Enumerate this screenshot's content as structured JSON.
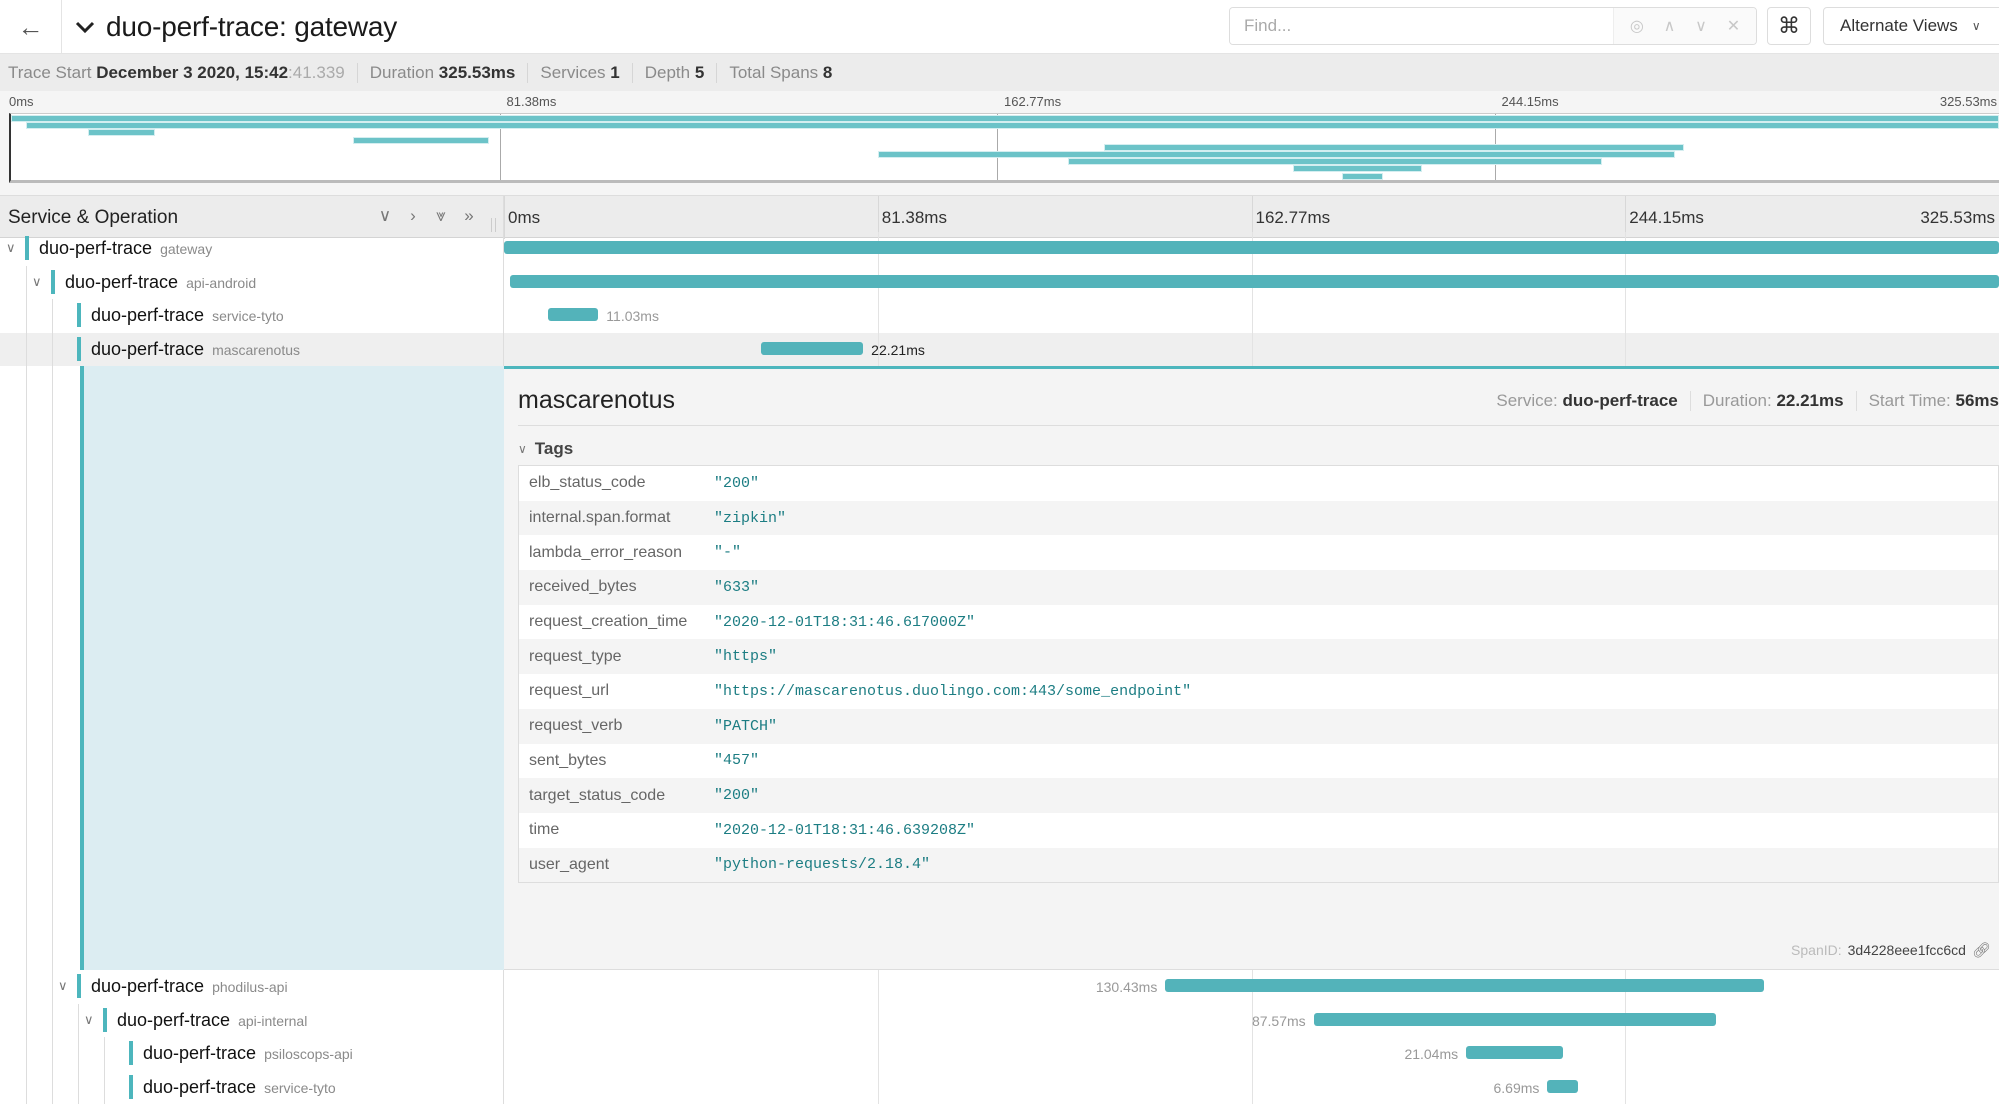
{
  "header": {
    "back_icon": "arrow-left-icon",
    "title": "duo-perf-trace: gateway",
    "find_placeholder": "Find...",
    "find_value": "",
    "find_controls": {
      "locate": "◎",
      "prev": "∧",
      "next": "∨",
      "clear": "✕"
    },
    "shortcut_label": "⌘",
    "alt_views_label": "Alternate Views",
    "alt_views_chevron": "∨"
  },
  "summary": {
    "trace_start_label": "Trace Start",
    "trace_start_value": "December 3 2020, 15:42",
    "trace_start_faint": ":41.339",
    "duration_label": "Duration",
    "duration_value": "325.53ms",
    "services_label": "Services",
    "services_value": "1",
    "depth_label": "Depth",
    "depth_value": "5",
    "total_spans_label": "Total Spans",
    "total_spans_value": "8"
  },
  "timeline": {
    "ticks": [
      "0ms",
      "81.38ms",
      "162.77ms",
      "244.15ms",
      "325.53ms"
    ],
    "total_ms": 325.53
  },
  "minimap_spans": [
    {
      "start_ms": 0,
      "duration_ms": 325.53
    },
    {
      "start_ms": 2.5,
      "duration_ms": 323.0
    },
    {
      "start_ms": 12.6,
      "duration_ms": 11.03
    },
    {
      "start_ms": 56.0,
      "duration_ms": 22.21
    },
    {
      "start_ms": 179.0,
      "duration_ms": 95.0
    },
    {
      "start_ms": 142.0,
      "duration_ms": 130.43
    },
    {
      "start_ms": 173.0,
      "duration_ms": 87.57
    },
    {
      "start_ms": 210.0,
      "duration_ms": 21.04
    },
    {
      "start_ms": 218.0,
      "duration_ms": 6.69
    }
  ],
  "column_header": {
    "title": "Service & Operation",
    "controls": [
      "∨",
      "›",
      "⩔",
      "»"
    ]
  },
  "spans": [
    {
      "service": "duo-perf-trace",
      "operation": "gateway",
      "depth": 0,
      "collapsible": true,
      "start_ms": 0,
      "duration_ms": 325.53,
      "label": ""
    },
    {
      "service": "duo-perf-trace",
      "operation": "api-android",
      "depth": 1,
      "collapsible": true,
      "start_ms": 1.2,
      "duration_ms": 324.3,
      "label": ""
    },
    {
      "service": "duo-perf-trace",
      "operation": "service-tyto",
      "depth": 2,
      "collapsible": false,
      "start_ms": 9.5,
      "duration_ms": 11.03,
      "label": "11.03ms"
    },
    {
      "service": "duo-perf-trace",
      "operation": "mascarenotus",
      "depth": 2,
      "collapsible": false,
      "start_ms": 56.0,
      "duration_ms": 22.21,
      "label": "22.21ms",
      "selected": true
    }
  ],
  "spans_after": [
    {
      "service": "duo-perf-trace",
      "operation": "phodilus-api",
      "depth": 2,
      "collapsible": true,
      "start_ms": 144.0,
      "duration_ms": 130.43,
      "label": "130.43ms"
    },
    {
      "service": "duo-perf-trace",
      "operation": "api-internal",
      "depth": 3,
      "collapsible": true,
      "start_ms": 176.3,
      "duration_ms": 87.57,
      "label": "87.57ms"
    },
    {
      "service": "duo-perf-trace",
      "operation": "psiloscops-api",
      "depth": 4,
      "collapsible": false,
      "start_ms": 209.5,
      "duration_ms": 21.04,
      "label": "21.04ms"
    },
    {
      "service": "duo-perf-trace",
      "operation": "service-tyto",
      "depth": 4,
      "collapsible": false,
      "start_ms": 227.2,
      "duration_ms": 6.69,
      "label": "6.69ms"
    }
  ],
  "detail": {
    "title": "mascarenotus",
    "service_label": "Service:",
    "service_value": "duo-perf-trace",
    "duration_label": "Duration:",
    "duration_value": "22.21ms",
    "start_label": "Start Time:",
    "start_value": "56ms",
    "tags_label": "Tags",
    "tags": [
      {
        "key": "elb_status_code",
        "value": "\"200\""
      },
      {
        "key": "internal.span.format",
        "value": "\"zipkin\""
      },
      {
        "key": "lambda_error_reason",
        "value": "\"-\""
      },
      {
        "key": "received_bytes",
        "value": "\"633\""
      },
      {
        "key": "request_creation_time",
        "value": "\"2020-12-01T18:31:46.617000Z\""
      },
      {
        "key": "request_type",
        "value": "\"https\""
      },
      {
        "key": "request_url",
        "value": "\"https://mascarenotus.duolingo.com:443/some_endpoint\""
      },
      {
        "key": "request_verb",
        "value": "\"PATCH\""
      },
      {
        "key": "sent_bytes",
        "value": "\"457\""
      },
      {
        "key": "target_status_code",
        "value": "\"200\""
      },
      {
        "key": "time",
        "value": "\"2020-12-01T18:31:46.639208Z\""
      },
      {
        "key": "user_agent",
        "value": "\"python-requests/2.18.4\""
      }
    ],
    "span_id_label": "SpanID:",
    "span_id_value": "3d4228eee1fcc6cd"
  },
  "colors": {
    "accent": "#4db6bd",
    "bar": "#53b3ba",
    "minimap_bar": "#6cc3c8",
    "detail_bg": "#dcedf2"
  }
}
